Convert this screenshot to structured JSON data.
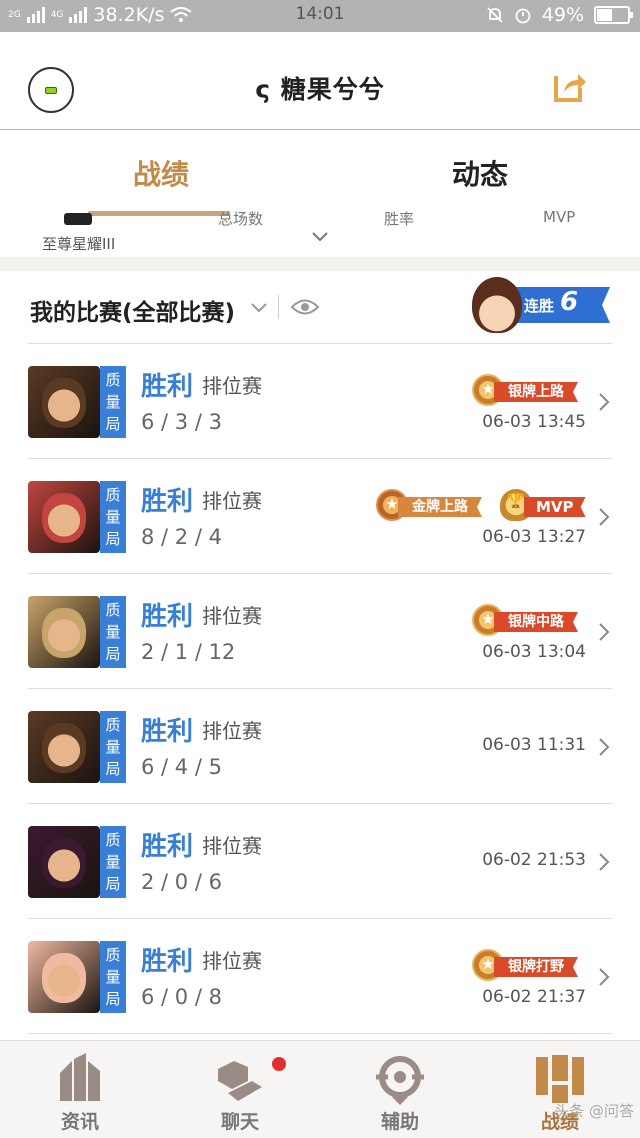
{
  "statusbar": {
    "signal_1": "2G",
    "signal_2": "4G",
    "speed": "38.2K/s",
    "time": "14:01",
    "battery": "49%",
    "battery_level": 0.49
  },
  "header": {
    "title": "ς 糖果兮兮",
    "menu_icon": "menu-circle-icon",
    "share_icon": "share-icon"
  },
  "tabs": [
    {
      "label": "战绩",
      "active": true
    },
    {
      "label": "动态",
      "active": false
    }
  ],
  "stats": {
    "rank_name": "至尊星耀III",
    "labels": [
      "总场数",
      "胜率",
      "MVP"
    ]
  },
  "filter": {
    "label": "我的比赛(全部比赛)",
    "streak_label": "连胜",
    "streak_count": "6"
  },
  "matches": [
    {
      "hero_color": "#5b3a24",
      "quality": [
        "质",
        "量",
        "局"
      ],
      "result": "胜利",
      "mode": "排位赛",
      "kda": "6 / 3 / 3",
      "time": "06-03 13:45",
      "badge": {
        "type": "silver",
        "label": "银牌上路"
      },
      "mvp": null
    },
    {
      "hero_color": "#c2453f",
      "quality": [
        "质",
        "量",
        "局"
      ],
      "result": "胜利",
      "mode": "排位赛",
      "kda": "8 / 2 / 4",
      "time": "06-03 13:27",
      "badge": {
        "type": "gold",
        "label": "金牌上路"
      },
      "mvp": "MVP"
    },
    {
      "hero_color": "#c9a46a",
      "quality": [
        "质",
        "量",
        "局"
      ],
      "result": "胜利",
      "mode": "排位赛",
      "kda": "2 / 1 / 12",
      "time": "06-03 13:04",
      "badge": {
        "type": "silver",
        "label": "银牌中路"
      },
      "mvp": null
    },
    {
      "hero_color": "#5b3a24",
      "quality": [
        "质",
        "量",
        "局"
      ],
      "result": "胜利",
      "mode": "排位赛",
      "kda": "6 / 4 / 5",
      "time": "06-03 11:31",
      "badge": null,
      "mvp": null
    },
    {
      "hero_color": "#3a1a2e",
      "quality": [
        "质",
        "量",
        "局"
      ],
      "result": "胜利",
      "mode": "排位赛",
      "kda": "2 / 0 / 6",
      "time": "06-02 21:53",
      "badge": null,
      "mvp": null
    },
    {
      "hero_color": "#f0b9a0",
      "quality": [
        "质",
        "量",
        "局"
      ],
      "result": "胜利",
      "mode": "排位赛",
      "kda": "6 / 0 / 8",
      "time": "06-02 21:37",
      "badge": {
        "type": "silver",
        "label": "银牌打野"
      },
      "mvp": null
    }
  ],
  "bottomnav": [
    {
      "label": "资讯",
      "icon": "news-icon",
      "active": false
    },
    {
      "label": "聊天",
      "icon": "chat-icon",
      "active": false,
      "dot": true
    },
    {
      "label": "辅助",
      "icon": "assist-icon",
      "active": false
    },
    {
      "label": "战绩",
      "icon": "record-icon",
      "active": true
    }
  ],
  "watermark": "头条 @问答",
  "colors": {
    "accent": "#c28a48",
    "win_blue": "#3a7fd6",
    "ribbon_red": "#d94a2a"
  }
}
